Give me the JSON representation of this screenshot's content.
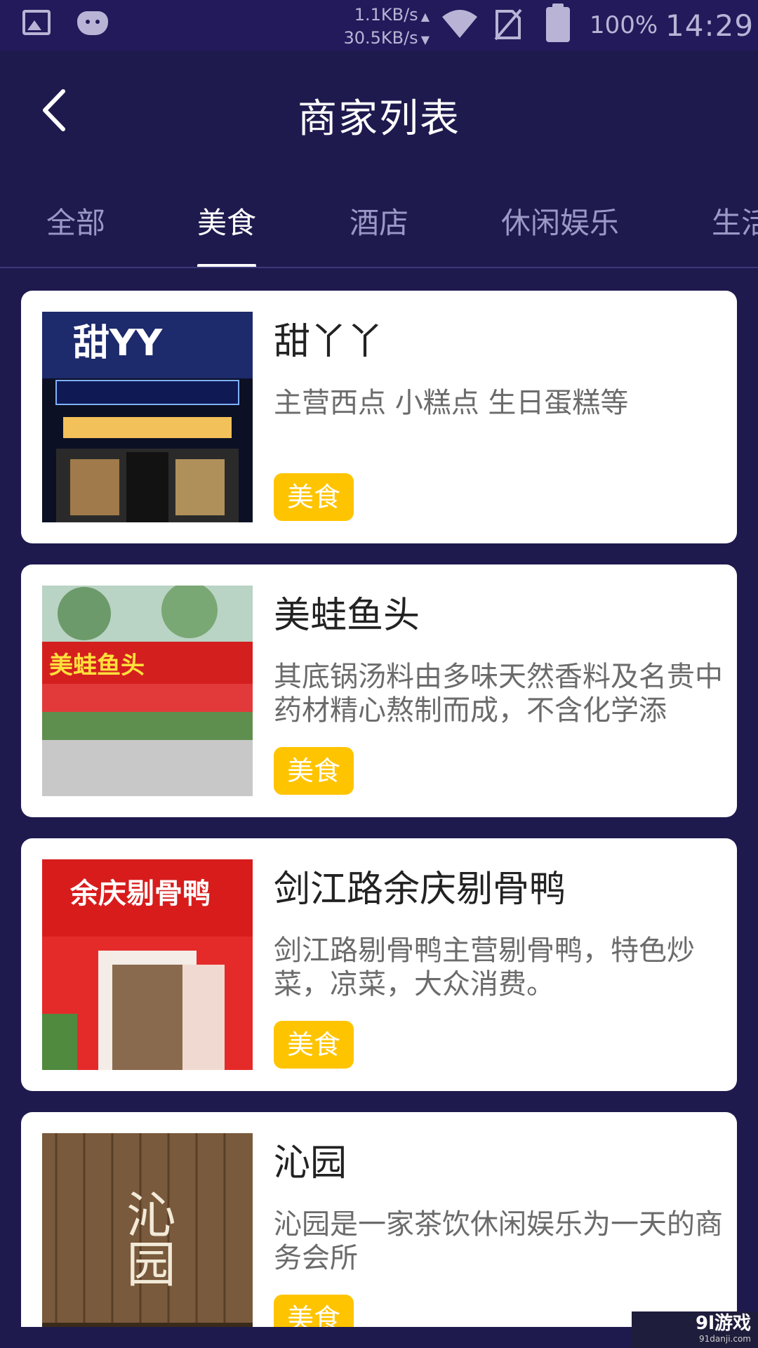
{
  "status_bar": {
    "net_up": "1.1KB/s",
    "net_down": "30.5KB/s",
    "battery_pct": "100%",
    "time": "14:29",
    "icons": [
      "image-icon",
      "pig-icon",
      "wifi-icon",
      "no-sim-icon",
      "battery-icon"
    ]
  },
  "header": {
    "title": "商家列表",
    "back_icon": "chevron-left-icon"
  },
  "tabs": {
    "items": [
      {
        "label": "全部"
      },
      {
        "label": "美食"
      },
      {
        "label": "酒店"
      },
      {
        "label": "休闲娱乐"
      },
      {
        "label": "生活"
      }
    ],
    "active_index": 1
  },
  "merchants": [
    {
      "name": "甜丫丫",
      "desc": "主营西点 小糕点  生日蛋糕等",
      "tag": "美食",
      "sign_text": "甜YY"
    },
    {
      "name": "美蛙鱼头",
      "desc": "其底锅汤料由多味天然香料及名贵中药材精心熬制而成，不含化学添",
      "tag": "美食",
      "sign_text": "美蛙鱼头"
    },
    {
      "name": "剑江路余庆剔骨鸭",
      "desc": "剑江路剔骨鸭主营剔骨鸭，特色炒菜，凉菜，大众消费。",
      "tag": "美食",
      "sign_text": "余庆剔骨鸭"
    },
    {
      "name": "沁园",
      "desc": "沁园是一家茶饮休闲娱乐为一天的商务会所",
      "tag": "美食",
      "sign_text": "沁园"
    }
  ],
  "watermark": {
    "main": "9l游戏",
    "sub": "91danji.com"
  },
  "colors": {
    "background": "#1e1a4e",
    "tag": "#ffc400",
    "card": "#ffffff"
  }
}
